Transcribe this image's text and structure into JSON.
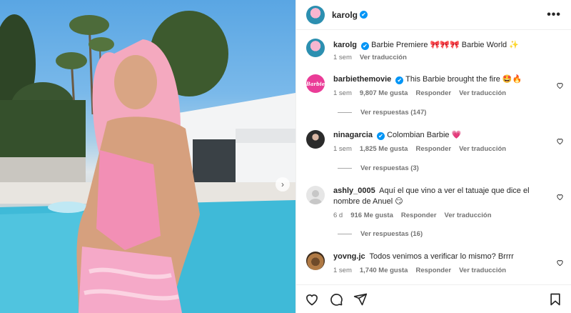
{
  "post": {
    "author": "karolg",
    "caption": "Barbie Premiere 🎀🎀🎀 Barbie World ✨",
    "time": "1 sem",
    "translate": "Ver traducción"
  },
  "comments": [
    {
      "user": "barbiethemovie",
      "verified": true,
      "avatar_text": "Barbie",
      "text": "This Barbie brought the fire 🤩🔥",
      "time": "1 sem",
      "likes": "9,807 Me gusta",
      "reply": "Responder",
      "translate": "Ver traducción",
      "replies": "Ver respuestas (147)"
    },
    {
      "user": "ninagarcia",
      "verified": true,
      "text": "Colombian Barbie 💗",
      "time": "1 sem",
      "likes": "1,825 Me gusta",
      "reply": "Responder",
      "translate": "Ver traducción",
      "replies": "Ver respuestas (3)"
    },
    {
      "user": "ashly_0005",
      "verified": false,
      "text": "Aquí el que vino a ver el tatuaje que dice el nombre de Anuel 😏",
      "time": "6 d",
      "likes": "916 Me gusta",
      "reply": "Responder",
      "translate": "Ver traducción",
      "replies": "Ver respuestas (16)"
    },
    {
      "user": "yovng.jc",
      "verified": false,
      "text": "Todos venimos a verificar lo mismo? Brrrr",
      "time": "1 sem",
      "likes": "1,740 Me gusta",
      "reply": "Responder",
      "translate": "Ver traducción"
    }
  ],
  "icons": {
    "verified": "✔",
    "more": "•••",
    "carousel_next": "›"
  },
  "colors": {
    "verified": "#0095f6",
    "secondary_text": "#737373",
    "barbie_pink": "#ea3c97"
  }
}
